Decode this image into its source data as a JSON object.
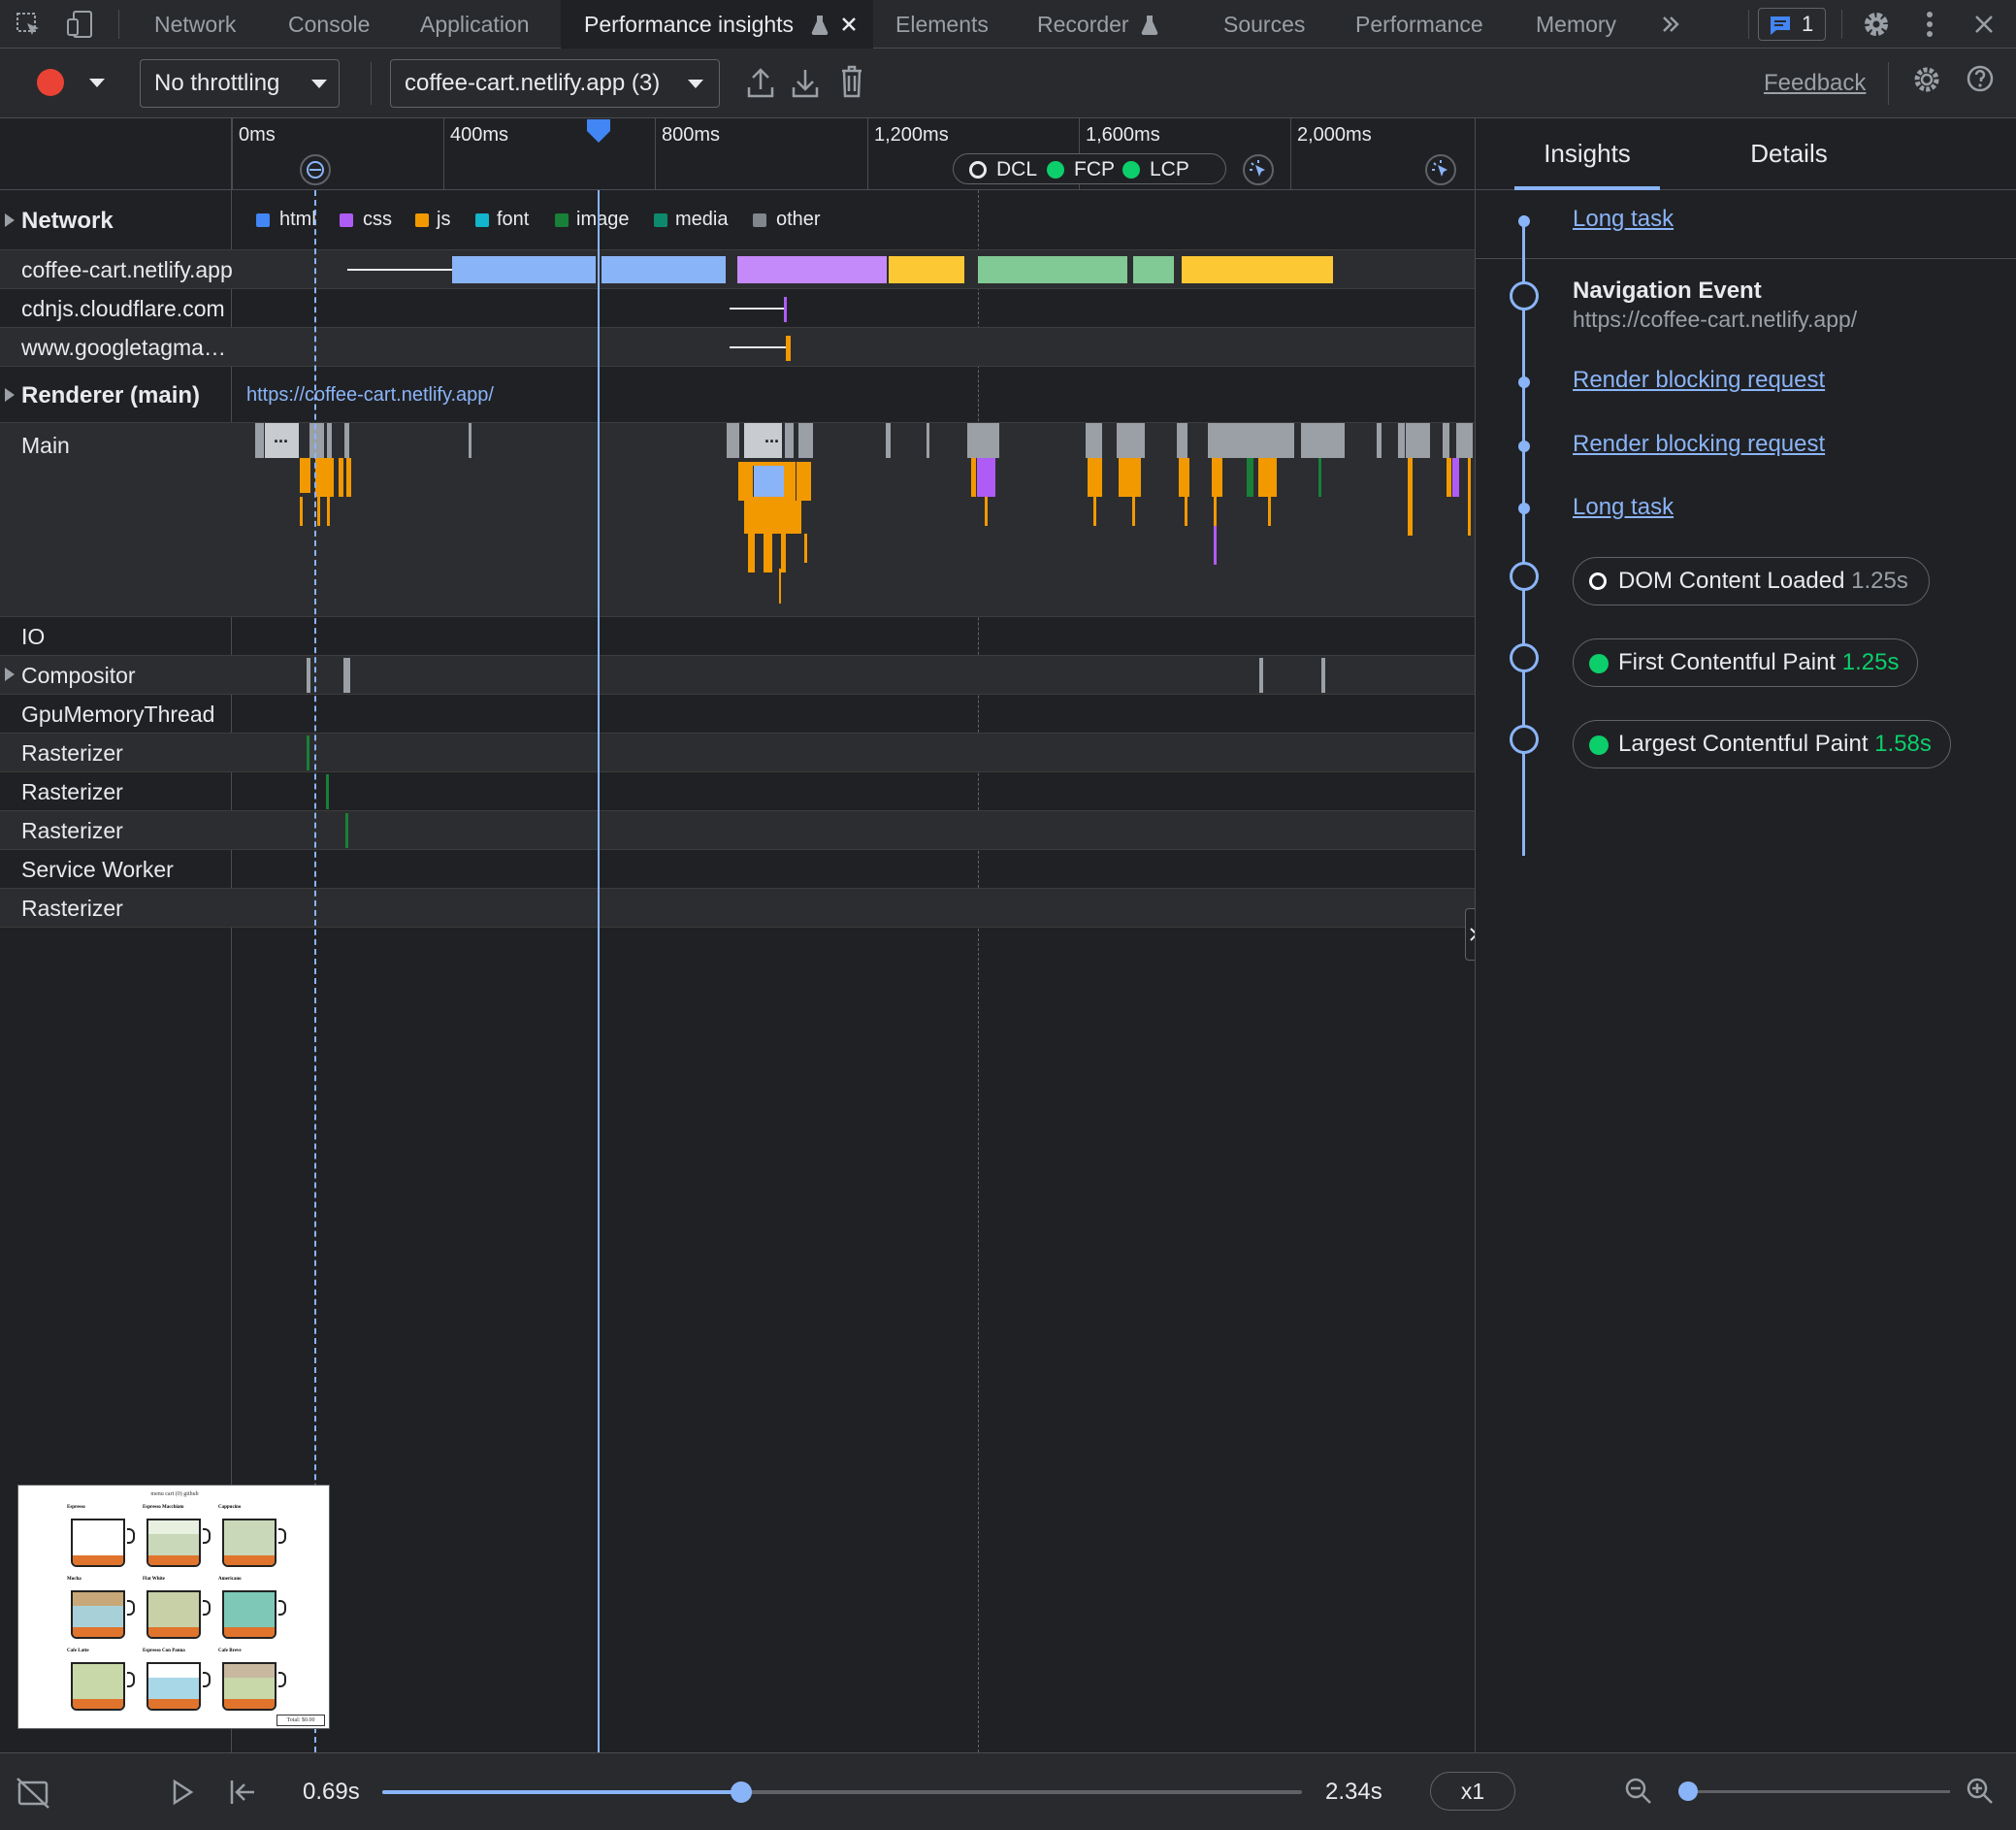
{
  "tabs": [
    {
      "label": "Network"
    },
    {
      "label": "Console"
    },
    {
      "label": "Application"
    },
    {
      "label": "Performance insights",
      "active": true
    },
    {
      "label": "Elements"
    },
    {
      "label": "Recorder"
    },
    {
      "label": "Sources"
    },
    {
      "label": "Performance"
    },
    {
      "label": "Memory"
    }
  ],
  "tabbar": {
    "more_icon": "chevrons-right-icon",
    "issues_count": "1",
    "settings_icon": "gear-icon",
    "menu_icon": "kebab-menu-icon",
    "close_icon": "close-icon"
  },
  "toolbar": {
    "throttling": "No throttling",
    "recording": "coffee-cart.netlify.app (3)",
    "feedback": "Feedback"
  },
  "ruler": {
    "ticks": [
      "0ms",
      "400ms",
      "800ms",
      "1,200ms",
      "1,600ms",
      "2,000ms"
    ],
    "markers": [
      "DCL",
      "FCP",
      "LCP"
    ]
  },
  "legend": [
    {
      "label": "html",
      "color": "#4285f4"
    },
    {
      "label": "css",
      "color": "#af5cf7"
    },
    {
      "label": "js",
      "color": "#f29900"
    },
    {
      "label": "font",
      "color": "#12b5cb"
    },
    {
      "label": "image",
      "color": "#188038"
    },
    {
      "label": "media",
      "color": "#0d8a6e"
    },
    {
      "label": "other",
      "color": "#80868b"
    }
  ],
  "tracks": {
    "network": "Network",
    "network_rows": [
      "coffee-cart.netlify.app",
      "cdnjs.cloudflare.com",
      "www.googletagma…"
    ],
    "renderer": "Renderer (main)",
    "renderer_url": "https://coffee-cart.netlify.app/",
    "main": "Main",
    "main_more": "...",
    "threads": [
      "IO",
      "Compositor",
      "GpuMemoryThread",
      "Rasterizer",
      "Rasterizer",
      "Rasterizer",
      "Service Worker",
      "Rasterizer"
    ]
  },
  "insights": {
    "tab_insights": "Insights",
    "tab_details": "Details",
    "items": [
      {
        "type": "link",
        "label": "Long task"
      },
      {
        "type": "nav",
        "title": "Navigation Event",
        "url": "https://coffee-cart.netlify.app/"
      },
      {
        "type": "link",
        "label": "Render blocking request"
      },
      {
        "type": "link",
        "label": "Render blocking request"
      },
      {
        "type": "link",
        "label": "Long task"
      }
    ],
    "metrics": [
      {
        "label": "DOM Content Loaded",
        "value": "1.25s",
        "color": "#ffffff",
        "hollow": true
      },
      {
        "label": "First Contentful Paint",
        "value": "1.25s",
        "color": "#0cce6b"
      },
      {
        "label": "Largest Contentful Paint",
        "value": "1.58s",
        "color": "#0cce6b"
      }
    ]
  },
  "playback": {
    "current": "0.69s",
    "total": "2.34s",
    "speed": "x1",
    "progress": 0.39,
    "zoom": 0.0
  },
  "thumbnail": {
    "header": "menu   cart (0)   github",
    "total": "Total: $0.00",
    "drinks": [
      "Espresso",
      "Espresso Macchiato",
      "Cappucino",
      "Mocha",
      "Flat White",
      "Americano",
      "Cafe Latte",
      "Espresso Con Panna",
      "Cafe Breve"
    ]
  }
}
